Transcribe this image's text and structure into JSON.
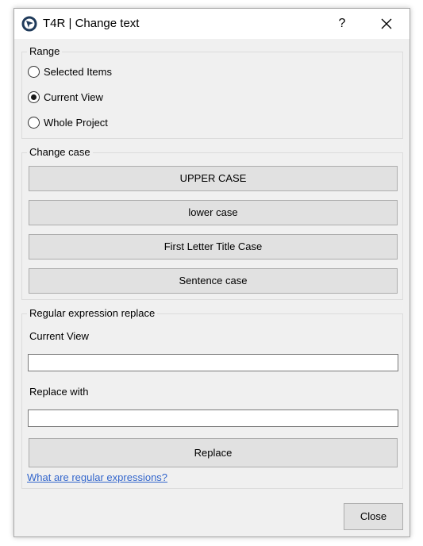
{
  "window": {
    "title": "T4R | Change text",
    "help_label": "?"
  },
  "range": {
    "legend": "Range",
    "options": [
      {
        "label": "Selected Items",
        "checked": false
      },
      {
        "label": "Current View",
        "checked": true
      },
      {
        "label": "Whole Project",
        "checked": false
      }
    ]
  },
  "change_case": {
    "legend": "Change case",
    "buttons": [
      "UPPER CASE",
      "lower case",
      "First Letter Title Case",
      "Sentence case"
    ]
  },
  "regex": {
    "legend": "Regular expression replace",
    "find_label": "Current View",
    "find_value": "",
    "replace_label": "Replace with",
    "replace_value": "",
    "replace_button": "Replace",
    "help_link": "What are regular expressions?"
  },
  "footer": {
    "close_label": "Close"
  },
  "colors": {
    "dialog_bg": "#f0f0f0",
    "button_bg": "#e1e1e1",
    "link": "#3366cc"
  }
}
